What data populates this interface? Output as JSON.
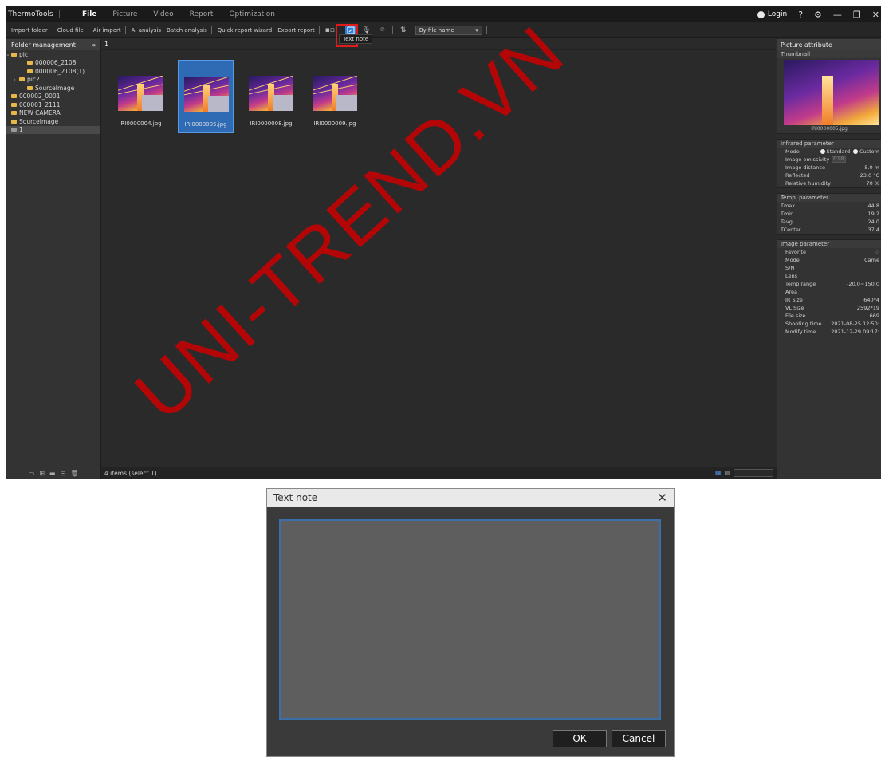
{
  "app": {
    "title": "ThermoTools",
    "menu": [
      "File",
      "Picture",
      "Video",
      "Report",
      "Optimization"
    ],
    "login": "Login",
    "controls": {
      "help": "?",
      "settings": "⚙",
      "minimize": "—",
      "restore": "❐",
      "close": "✕"
    }
  },
  "toolbar": {
    "import_folder": "Import folder",
    "cloud_file": "Cloud file",
    "air_import": "Air import",
    "ai_analysis": "AI analysis",
    "batch_analysis": "Batch analysis",
    "quick_report": "Quick report wizard",
    "export_report": "Export report",
    "sort_value": "By file name",
    "tooltip": "Text note"
  },
  "left_panel": {
    "title": "Folder management",
    "collapse": "«",
    "tree": [
      {
        "label": "pic",
        "indent": 0,
        "arrow": "⌄"
      },
      {
        "label": "000006_2108",
        "indent": 2
      },
      {
        "label": "000006_2108(1)",
        "indent": 2
      },
      {
        "label": "pic2",
        "indent": 1,
        "arrow": "›"
      },
      {
        "label": "SourceImage",
        "indent": 2
      },
      {
        "label": "000002_0001",
        "indent": 0
      },
      {
        "label": "000001_2111",
        "indent": 0
      },
      {
        "label": "NEW CAMERA",
        "indent": 0
      },
      {
        "label": "SourceImage",
        "indent": 0
      },
      {
        "label": "1",
        "indent": 0,
        "selected": true
      }
    ]
  },
  "center": {
    "header": "1",
    "thumbnails": [
      {
        "name": "IRI0000004.jpg",
        "selected": false
      },
      {
        "name": "IRI0000005.jpg",
        "selected": true
      },
      {
        "name": "IRI0000008.jpg",
        "selected": false
      },
      {
        "name": "IRI0000009.jpg",
        "selected": false
      }
    ],
    "status": "4 items (select 1)"
  },
  "right_panel": {
    "title": "Picture attribute",
    "thumbnail_label": "Thumbnail",
    "thumbnail_name": "IRI0000005.jpg",
    "infrared": {
      "title": "Infrared parameter",
      "mode_label": "Mode",
      "mode_standard": "Standard",
      "mode_custom": "Custom",
      "emissivity_label": "Image emissivity",
      "emissivity_value": "0.98",
      "distance_label": "Image distance",
      "distance_value": "5.0 m",
      "reflected_label": "Reflected",
      "reflected_value": "23.0 °C",
      "humidity_label": "Relative humidity",
      "humidity_value": "70 %"
    },
    "temp": {
      "title": "Temp. parameter",
      "rows": [
        {
          "label": "Tmax",
          "value": "44.8"
        },
        {
          "label": "Tmin",
          "value": "19.2"
        },
        {
          "label": "Tavg",
          "value": "24.0"
        },
        {
          "label": "TCenter",
          "value": "37.4"
        }
      ]
    },
    "image": {
      "title": "Image parameter",
      "rows": [
        {
          "label": "Favorite",
          "value": "♡"
        },
        {
          "label": "Model",
          "value": "Came"
        },
        {
          "label": "S/N",
          "value": ""
        },
        {
          "label": "Lens",
          "value": ""
        },
        {
          "label": "Temp range",
          "value": "-20.0~150.0"
        },
        {
          "label": "Area",
          "value": ""
        },
        {
          "label": "IR Size",
          "value": "640*4"
        },
        {
          "label": "VL Size",
          "value": "2592*19"
        },
        {
          "label": "File size",
          "value": "669"
        },
        {
          "label": "Shooting time",
          "value": "2021-08-25 12:50:"
        },
        {
          "label": "Modify time",
          "value": "2021-12-29 09:17:"
        }
      ]
    }
  },
  "dialog": {
    "title": "Text note",
    "close": "✕",
    "text_value": "",
    "ok": "OK",
    "cancel": "Cancel"
  },
  "watermark": "UNI-TREND.VN"
}
